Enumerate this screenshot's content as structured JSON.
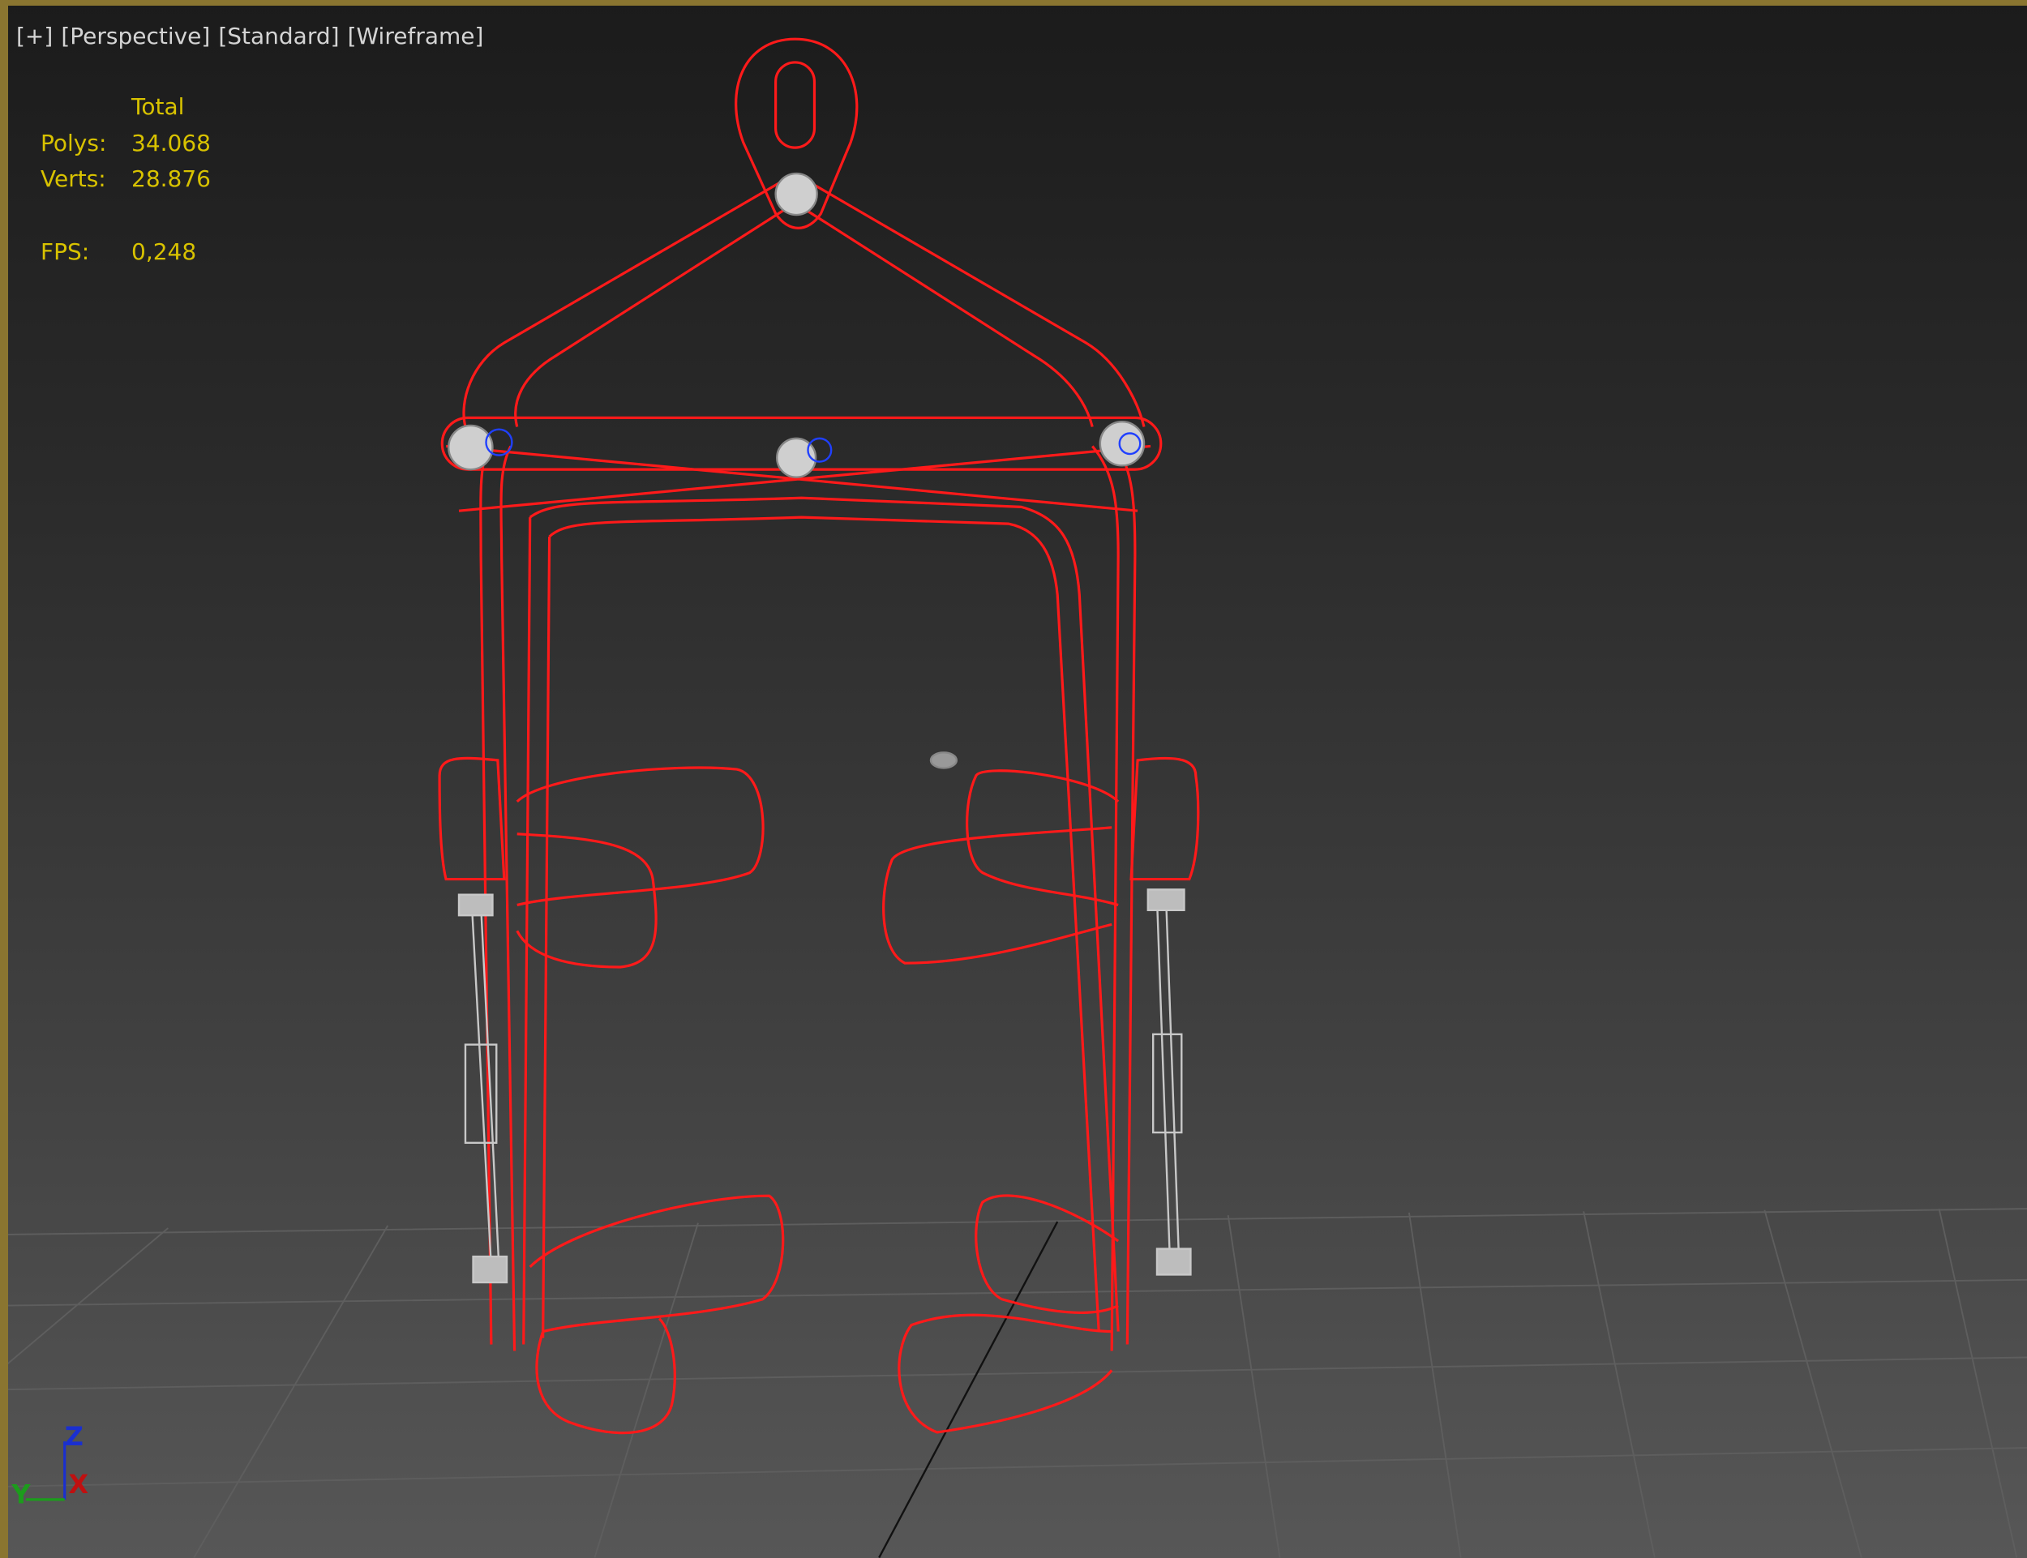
{
  "viewport": {
    "menu": [
      "[+]",
      "[Perspective]",
      "[Standard]",
      "[Wireframe]"
    ]
  },
  "stats": {
    "header": "Total",
    "polys_label": "Polys:",
    "polys_value": "34.068",
    "verts_label": "Verts:",
    "verts_value": "28.876",
    "fps_label": "FPS:",
    "fps_value": "0,248"
  },
  "gizmo": {
    "x": "X",
    "y": "Y",
    "z": "Z"
  },
  "colors": {
    "wire": "#ff1a1a",
    "border": "#8a7530",
    "stats": "#d8c200"
  }
}
